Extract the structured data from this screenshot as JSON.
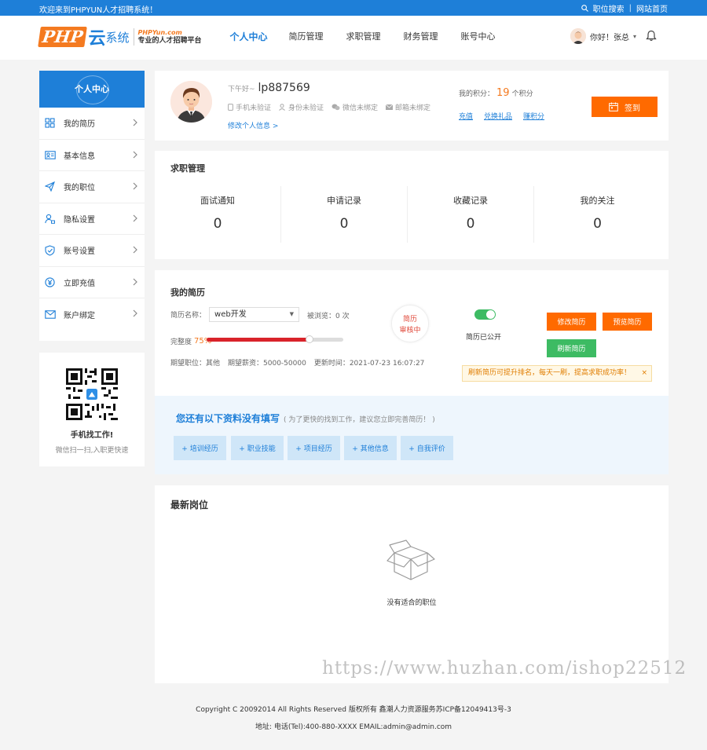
{
  "topbar": {
    "welcome": "欢迎来到PHPYUN人才招聘系统！",
    "search": "职位搜索",
    "home": "网站首页",
    "sep": "|"
  },
  "logo": {
    "php": "PHP",
    "yun": "云",
    "sys": "系统",
    "domain": "PHPYun.com",
    "slogan": "专业的人才招聘平台"
  },
  "nav": [
    {
      "label": "个人中心",
      "active": true
    },
    {
      "label": "简历管理"
    },
    {
      "label": "求职管理"
    },
    {
      "label": "财务管理"
    },
    {
      "label": "账号中心"
    }
  ],
  "user": {
    "greeting": "你好！张总",
    "caret": "▾"
  },
  "sidebar": {
    "title": "个人中心",
    "items": [
      {
        "label": "我的简历",
        "icon": "grid-icon"
      },
      {
        "label": "基本信息",
        "icon": "id-card-icon"
      },
      {
        "label": "我的职位",
        "icon": "paper-plane-icon"
      },
      {
        "label": "隐私设置",
        "icon": "user-lock-icon"
      },
      {
        "label": "账号设置",
        "icon": "shield-check-icon"
      },
      {
        "label": "立即充值",
        "icon": "yen-coin-icon"
      },
      {
        "label": "账户绑定",
        "icon": "mail-icon"
      }
    ]
  },
  "qr": {
    "title": "手机找工作!",
    "subtitle": "微信扫一扫,入职更快速"
  },
  "profile": {
    "greeting": "下午好~",
    "username": "lp887569",
    "verifications": [
      "手机未验证",
      "身份未验证",
      "微信未绑定",
      "邮箱未绑定"
    ],
    "edit": "修改个人信息 >",
    "points_label": "我的积分：",
    "points": "19",
    "points_unit": "个积分",
    "links": [
      "充值",
      "兑换礼品",
      "赚积分"
    ],
    "signin": "签到"
  },
  "jobs": {
    "title": "求职管理",
    "stats": [
      {
        "label": "面试通知",
        "value": "0"
      },
      {
        "label": "申请记录",
        "value": "0"
      },
      {
        "label": "收藏记录",
        "value": "0"
      },
      {
        "label": "我的关注",
        "value": "0"
      }
    ]
  },
  "resume": {
    "title": "我的简历",
    "name_label": "简历名称：",
    "name": "web开发",
    "viewed": "被浏览：0 次",
    "completeness_label": "完整度",
    "completeness": "75%",
    "completeness_value": 75,
    "meta": [
      "期望职位：其他",
      "期望薪资：5000-50000",
      "更新时间：2021-07-23 16:07:27"
    ],
    "stamp_line1": "简历",
    "stamp_line2": "审核中",
    "public": "简历已公开",
    "btn_edit": "修改简历",
    "btn_preview": "预览简历",
    "btn_refresh": "刷新简历",
    "tip": "刷新简历可提升排名，每天一刷，提高求职成功率！",
    "tip_close": "×"
  },
  "incomplete": {
    "title": "您还有以下资料没有填写",
    "subtitle": "( 为了更快的找到工作，建议您立即完善简历！ )",
    "chips": [
      "+ 培训经历",
      "+ 职业技能",
      "+ 项目经历",
      "+ 其他信息",
      "+ 自我评价"
    ]
  },
  "latest": {
    "title": "最新岗位",
    "empty": "没有适合的职位"
  },
  "watermark": "https://www.huzhan.com/ishop22512",
  "footer": {
    "copyright": "Copyright C 20092014 All Rights Reserved 版权所有 鑫潮人力资源服务苏ICP备12049413号-3",
    "contact": "地址: 电话(Tel):400-880-XXXX EMAIL:admin@admin.com"
  },
  "colors": {
    "primary": "#1e7fd8",
    "orange": "#ff6a00",
    "green": "#3dbb63",
    "red": "#d9232a"
  }
}
